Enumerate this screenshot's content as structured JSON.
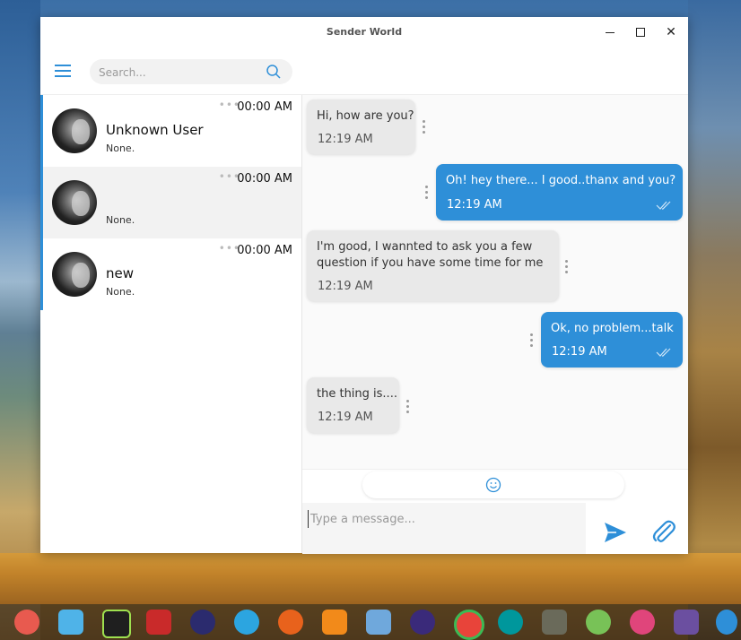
{
  "window": {
    "title": "Sender World",
    "close_glyph": "✕"
  },
  "search": {
    "placeholder": "Search..."
  },
  "contacts": [
    {
      "name": "Unknown User",
      "preview": "None.",
      "time": "00:00 AM",
      "dots": "•••"
    },
    {
      "name": "",
      "preview": "None.",
      "time": "00:00 AM",
      "dots": "•••"
    },
    {
      "name": "new",
      "preview": "None.",
      "time": "00:00 AM",
      "dots": "•••"
    }
  ],
  "messages": [
    {
      "dir": "in",
      "text": "Hi, how are you?",
      "time": "12:19 AM"
    },
    {
      "dir": "out",
      "text": "Oh! hey there... I good..thanx and you?",
      "time": "12:19 AM"
    },
    {
      "dir": "in",
      "text_line1": "I'm good, I wannted to ask you a few",
      "text_line2": "question if you have some time for me",
      "time": "12:19 AM"
    },
    {
      "dir": "out",
      "text": "Ok, no problem...talk",
      "time": "12:19 AM"
    },
    {
      "dir": "in",
      "text": "the thing is....",
      "time": "12:19 AM"
    }
  ],
  "composer": {
    "placeholder": "Type a message..."
  },
  "colors": {
    "accent": "#2e8fd8",
    "incoming_bubble": "#e9e9e9",
    "selected_row": "#f2f2f2"
  },
  "taskbar": {
    "icons": [
      "app-launcher-icon",
      "archive-icon",
      "pycharm-icon",
      "filezilla-icon",
      "eclipse-icon",
      "telegram-icon",
      "firefox-icon",
      "sublime-icon",
      "virtualbox-icon",
      "eclipse-ide-icon",
      "chrome-icon",
      "arduino-icon",
      "gimp-icon",
      "android-studio-icon",
      "settings-icon",
      "software-center-icon",
      "system-monitor-icon"
    ]
  }
}
